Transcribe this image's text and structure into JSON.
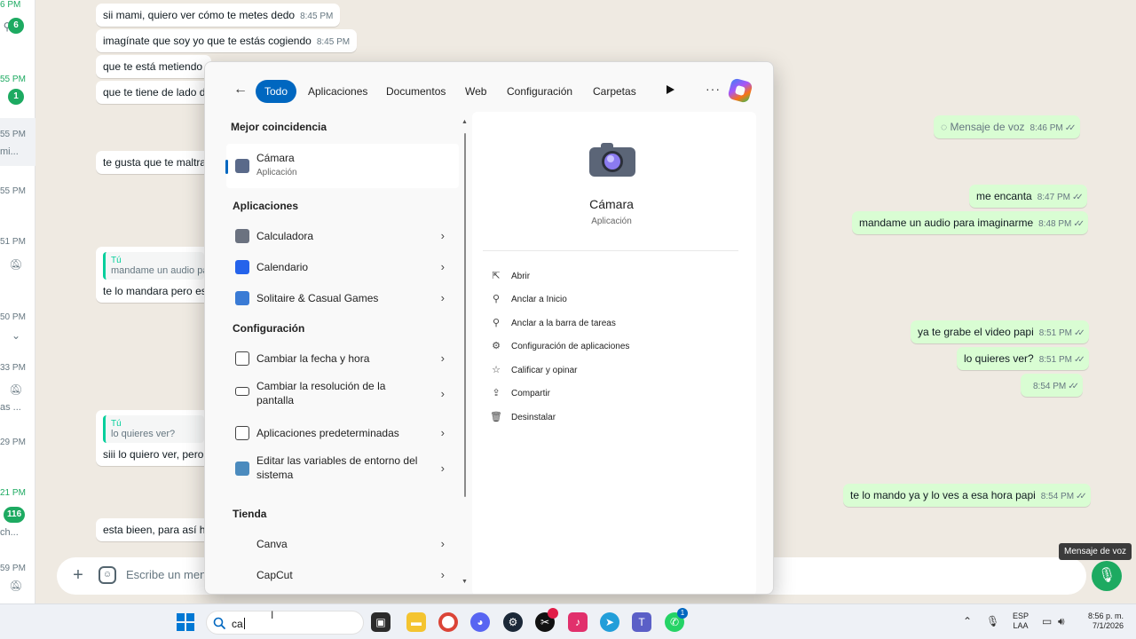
{
  "whatsapp": {
    "sidebar": [
      {
        "time": "6 PM",
        "badge": "6"
      },
      {
        "time": "55 PM",
        "badge": "1"
      },
      {
        "time": "55 PM",
        "text": "mi..."
      },
      {
        "time": "55 PM"
      },
      {
        "time": "51 PM",
        "icon": "mute-icon"
      },
      {
        "time": "50 PM",
        "icon": "chevron-down-icon"
      },
      {
        "time": "33 PM",
        "text": "as ...",
        "icon": "mute-icon"
      },
      {
        "time": "29 PM"
      },
      {
        "time": "21 PM",
        "badge": "116",
        "text": "ch..."
      },
      {
        "time": "59 PM",
        "icon": "mute-icon"
      }
    ],
    "incoming": [
      {
        "text": "sii mami, quiero ver cómo te metes dedo",
        "time": "8:45 PM"
      },
      {
        "text": "imagínate que soy yo que te estás cogiendo",
        "time": "8:45 PM"
      },
      {
        "text": "que te está metiendo"
      },
      {
        "text": "que te tiene de lado d"
      },
      {
        "text": "te gusta que te maltra"
      },
      {
        "quote_author": "Tú",
        "quote_text": "mandame un audio pa",
        "text": "te lo mandara pero es"
      },
      {
        "quote_author": "Tú",
        "quote_text": "lo quieres ver?",
        "text": "siii lo quiero ver, pero"
      },
      {
        "text": "esta bieen, para así ha"
      }
    ],
    "outgoing": [
      {
        "text": "Mensaje de voz",
        "time": "8:46 PM"
      },
      {
        "text": "me encanta",
        "time": "8:47 PM"
      },
      {
        "text": "mandame un audio para imaginarme",
        "time": "8:48 PM"
      },
      {
        "text": "ya te grabe el video papi",
        "time": "8:51 PM"
      },
      {
        "text": "lo quieres ver?",
        "time": "8:51 PM"
      },
      {
        "text": "",
        "time": "8:54 PM"
      },
      {
        "text": "te lo mando ya y lo ves a esa hora papi",
        "time": "8:54 PM"
      }
    ],
    "composer": {
      "placeholder": "Escribe un mensaje",
      "mic_tooltip": "Mensaje de voz"
    },
    "colors": {
      "green": "#1daa61",
      "outgoing_bubble": "#d9fdd3",
      "chat_bg": "#efeae2"
    }
  },
  "search_panel": {
    "filters": [
      "Todo",
      "Aplicaciones",
      "Documentos",
      "Web",
      "Configuración",
      "Carpetas"
    ],
    "active_filter": "Todo",
    "sections": {
      "best_match": "Mejor coincidencia",
      "apps": "Aplicaciones",
      "settings": "Configuración",
      "store": "Tienda"
    },
    "best_match": {
      "name": "Cámara",
      "type": "Aplicación"
    },
    "apps": [
      "Calculadora",
      "Calendario",
      "Solitaire & Casual Games"
    ],
    "settings": [
      "Cambiar la fecha y hora",
      "Cambiar la resolución de la pantalla",
      "Aplicaciones predeterminadas",
      "Editar las variables de entorno del sistema"
    ],
    "store": [
      "Canva",
      "CapCut"
    ],
    "detail": {
      "name": "Cámara",
      "type": "Aplicación",
      "actions": [
        {
          "label": "Abrir",
          "icon": "open-icon"
        },
        {
          "label": "Anclar a Inicio",
          "icon": "pin-icon"
        },
        {
          "label": "Anclar a la barra de tareas",
          "icon": "pin-icon"
        },
        {
          "label": "Configuración de aplicaciones",
          "icon": "gear-icon"
        },
        {
          "label": "Calificar y opinar",
          "icon": "star-icon"
        },
        {
          "label": "Compartir",
          "icon": "share-icon"
        },
        {
          "label": "Desinstalar",
          "icon": "trash-icon"
        }
      ]
    },
    "accent": "#0067c0"
  },
  "taskbar": {
    "search_text": "ca",
    "apps": [
      "file-explorer",
      "chrome",
      "discord",
      "steam",
      "capcut",
      "tiktok",
      "telegram",
      "teams",
      "whatsapp"
    ],
    "lang_top": "ESP",
    "lang_bottom": "LAA",
    "time": "8:56 p. m.",
    "date": "7/1/2026",
    "whatsapp_badge": "1"
  }
}
